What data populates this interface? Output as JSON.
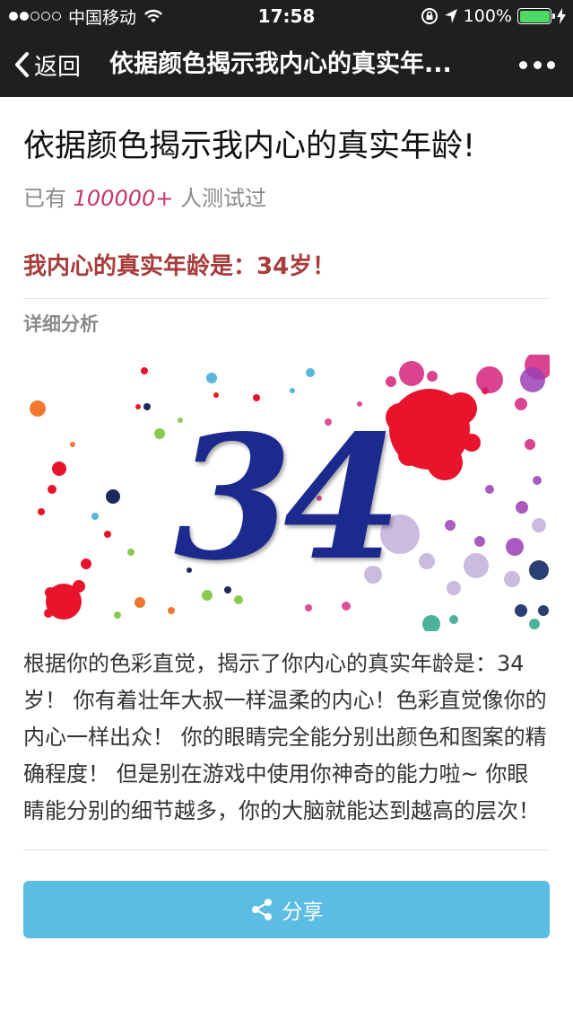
{
  "status_bar": {
    "carrier": "中国移动",
    "time": "17:58",
    "battery": "100%"
  },
  "nav": {
    "back_label": "返回",
    "title": "依据颜色揭示我内心的真实年..."
  },
  "page": {
    "title": "依据颜色揭示我内心的真实年龄!",
    "tested_prefix": "已有",
    "tested_count": "100000+",
    "tested_suffix": "人测试过",
    "result": "我内心的真实年龄是：34岁！",
    "section_label": "详细分析",
    "hero_number": "34",
    "description": "根据你的色彩直觉，揭示了你内心的真实年龄是：34岁！ 你有着壮年大叔一样温柔的内心！色彩直觉像你的内心一样出众！ 你的眼睛完全能分别出颜色和图案的精确程度！ 但是别在游戏中使用你神奇的能力啦~ 你眼睛能分别的细节越多，你的大脑就能达到越高的层次！",
    "share_label": "分享"
  },
  "icons": {
    "back": "chevron-left-icon",
    "more": "more-dots-icon",
    "share": "share-icon",
    "wifi": "wifi-icon",
    "location": "location-arrow-icon",
    "lock": "rotation-lock-icon",
    "charging": "bolt-icon"
  },
  "colors": {
    "nav_bg": "#1f1f22",
    "count": "#c4366b",
    "result": "#a83c3c",
    "share_button": "#5bbde3",
    "hero_number": "#1b2a8c"
  }
}
